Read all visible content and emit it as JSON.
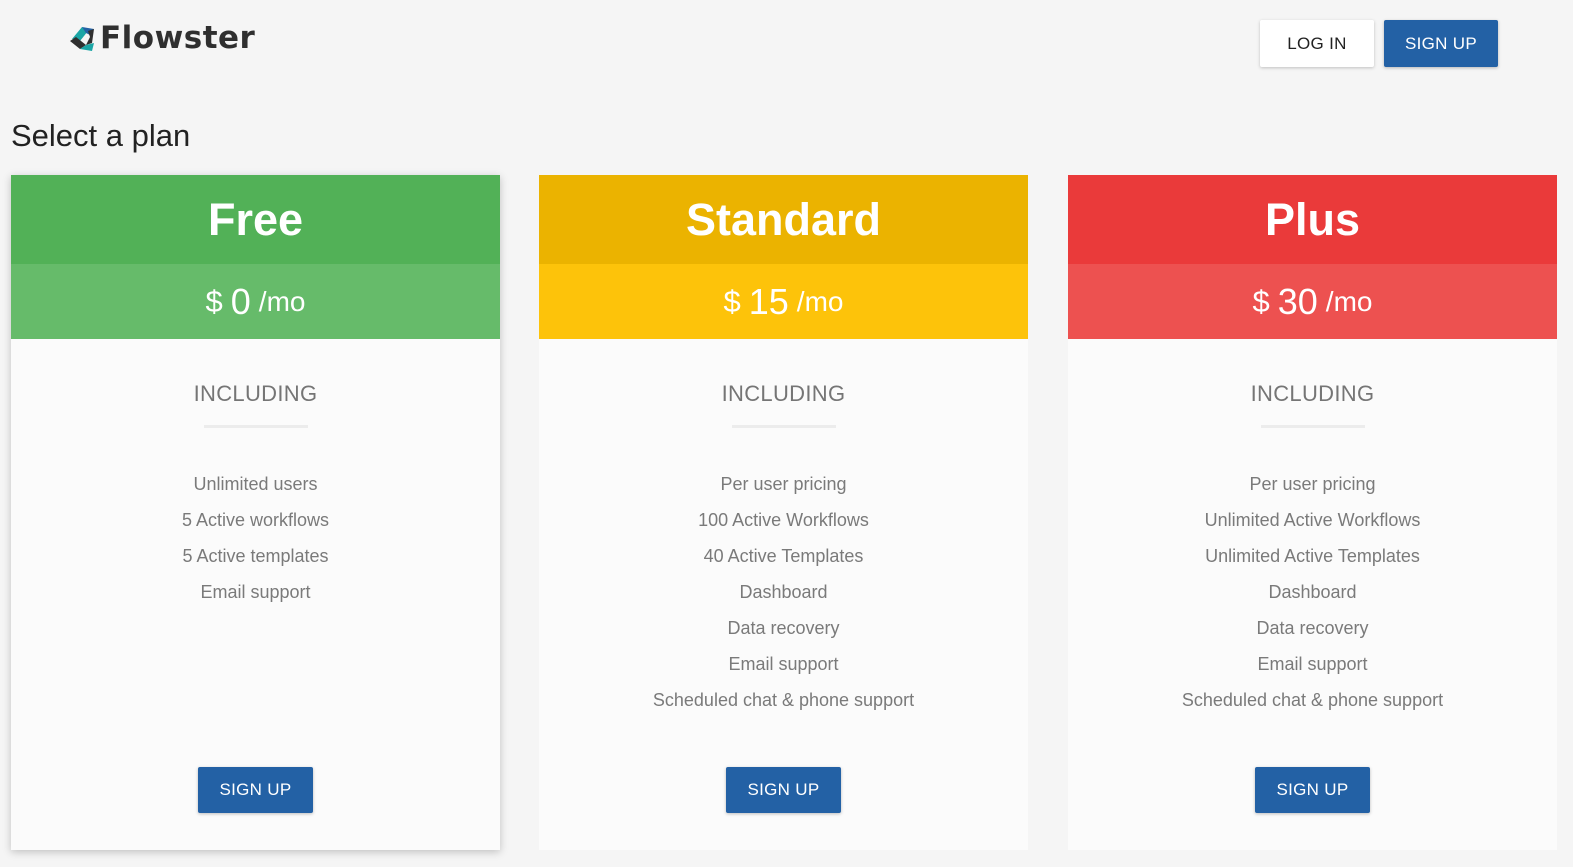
{
  "brand": {
    "name": "Flowster",
    "colors": {
      "logo_dark": "#2f2f2f",
      "logo_teal": "#1aa5a5",
      "logo_blue": "#2361a5"
    }
  },
  "header": {
    "login_label": "LOG IN",
    "signup_label": "SIGN UP"
  },
  "page": {
    "title": "Select a plan"
  },
  "plans": [
    {
      "name": "Free",
      "currency": "$",
      "amount": "0",
      "period": "/mo",
      "including_label": "INCLUDING",
      "features": [
        "Unlimited users",
        "5 Active workflows",
        "5 Active templates",
        "Email support"
      ],
      "button_label": "SIGN UP",
      "colors": {
        "head": "#52b157",
        "price": "#66bb6a"
      }
    },
    {
      "name": "Standard",
      "currency": "$",
      "amount": "15",
      "period": "/mo",
      "including_label": "INCLUDING",
      "features": [
        "Per user pricing",
        "100 Active Workflows",
        "40 Active Templates",
        "Dashboard",
        "Data recovery",
        "Email support",
        "Scheduled chat & phone support"
      ],
      "button_label": "SIGN UP",
      "colors": {
        "head": "#ebb300",
        "price": "#fdc30a"
      }
    },
    {
      "name": "Plus",
      "currency": "$",
      "amount": "30",
      "period": "/mo",
      "including_label": "INCLUDING",
      "features": [
        "Per user pricing",
        "Unlimited Active Workflows",
        "Unlimited Active Templates",
        "Dashboard",
        "Data recovery",
        "Email support",
        "Scheduled chat & phone support"
      ],
      "button_label": "SIGN UP",
      "colors": {
        "head": "#ea3a3a",
        "price": "#ed5150"
      }
    }
  ]
}
